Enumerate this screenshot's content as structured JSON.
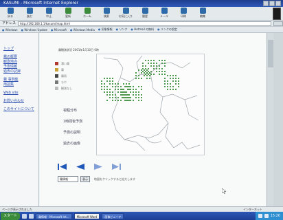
{
  "window": {
    "title": "KASUMI - Microsoft Internet Explorer"
  },
  "toolbar": {
    "buttons": [
      {
        "label": "戻る",
        "icon": "back-icon"
      },
      {
        "label": "進む",
        "icon": "forward-icon"
      },
      {
        "label": "中止",
        "icon": "stop-icon"
      },
      {
        "label": "更新",
        "icon": "refresh-icon"
      },
      {
        "label": "ホーム",
        "icon": "home-icon"
      },
      {
        "label": "検索",
        "icon": "search-icon"
      },
      {
        "label": "お気に入り",
        "icon": "favorites-icon"
      },
      {
        "label": "履歴",
        "icon": "history-icon"
      },
      {
        "label": "メール",
        "icon": "mail-icon"
      },
      {
        "label": "印刷",
        "icon": "print-icon"
      },
      {
        "label": "編集",
        "icon": "edit-icon"
      }
    ]
  },
  "address": {
    "label": "アドレス",
    "value": "http://192.168.1.1/kasumi/map.html",
    "go_label": "移動"
  },
  "links": [
    "Windows",
    "Windows Update",
    "Microsoft",
    "Windows Media",
    "気象情報",
    "リンク",
    "Hotmail の無料",
    "リンクの設定"
  ],
  "sidebar": {
    "links": [
      "トップ",
      "霧の概要",
      "観測地点",
      "予測情報",
      "過去の記録",
      "霧 事例集",
      "用語集",
      "Web site",
      "お問い合わせ",
      "このサイトについて"
    ]
  },
  "content": {
    "heading": "霧観測状況 2001年1月10日 0時",
    "legend": [
      {
        "label": "濃い霧",
        "color": "#b03a2e"
      },
      {
        "label": "霧",
        "color": "#c9a032"
      },
      {
        "label": "霧雨",
        "color": "#444444"
      },
      {
        "label": "もや",
        "color": "#777777"
      },
      {
        "label": "観測なし",
        "color": "#bbbbbb"
      }
    ],
    "panel_links": [
      "視程分布",
      "1時間後予測",
      "予測の説明",
      "過去の画像"
    ],
    "select_value": "霧情報",
    "select_button": "表示",
    "select_note": "地図をクリックすると拡大します"
  },
  "map_colors": {
    "land": "#fcfcfc",
    "border": "#9ea6ab",
    "fog_dot": "#4f9a4f"
  },
  "status": {
    "left": "ページが表示されました",
    "zone": "インターネット"
  },
  "taskbar": {
    "start": "スタート",
    "items": [
      "霧情報 - Microsoft Int...",
      "Microsoft Word",
      "画像ビューア"
    ],
    "clock": "15:20"
  }
}
